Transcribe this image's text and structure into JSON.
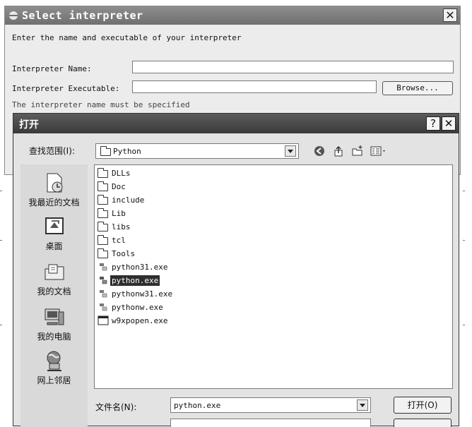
{
  "interpreter_dialog": {
    "title": "Select interpreter",
    "close_label": "✕",
    "description": "Enter the name and executable of your interpreter",
    "name_label": "Interpreter Name:",
    "name_value": "",
    "exec_label": "Interpreter Executable:",
    "exec_value": "",
    "browse_label": "Browse...",
    "error_message": "The interpreter name must be specified"
  },
  "open_dialog": {
    "title": "打开",
    "help_label": "?",
    "close_label": "✕",
    "look_in_label": "查找范围(I):",
    "look_in_value": "Python",
    "places": [
      {
        "label": "我最近的文档",
        "icon": "recent-documents-icon"
      },
      {
        "label": "桌面",
        "icon": "desktop-icon"
      },
      {
        "label": "我的文档",
        "icon": "my-documents-icon"
      },
      {
        "label": "我的电脑",
        "icon": "my-computer-icon"
      },
      {
        "label": "网上邻居",
        "icon": "network-places-icon"
      }
    ],
    "files": [
      {
        "name": "DLLs",
        "type": "folder"
      },
      {
        "name": "Doc",
        "type": "folder"
      },
      {
        "name": "include",
        "type": "folder"
      },
      {
        "name": "Lib",
        "type": "folder"
      },
      {
        "name": "libs",
        "type": "folder"
      },
      {
        "name": "tcl",
        "type": "folder"
      },
      {
        "name": "Tools",
        "type": "folder"
      },
      {
        "name": "python31.exe",
        "type": "python-exe"
      },
      {
        "name": "python.exe",
        "type": "python-exe",
        "selected": true
      },
      {
        "name": "pythonw31.exe",
        "type": "python-exe"
      },
      {
        "name": "pythonw.exe",
        "type": "python-exe"
      },
      {
        "name": "w9xpopen.exe",
        "type": "window-exe"
      }
    ],
    "filename_label": "文件名(N):",
    "filename_value": "python.exe",
    "open_button_label": "打开(O)"
  }
}
